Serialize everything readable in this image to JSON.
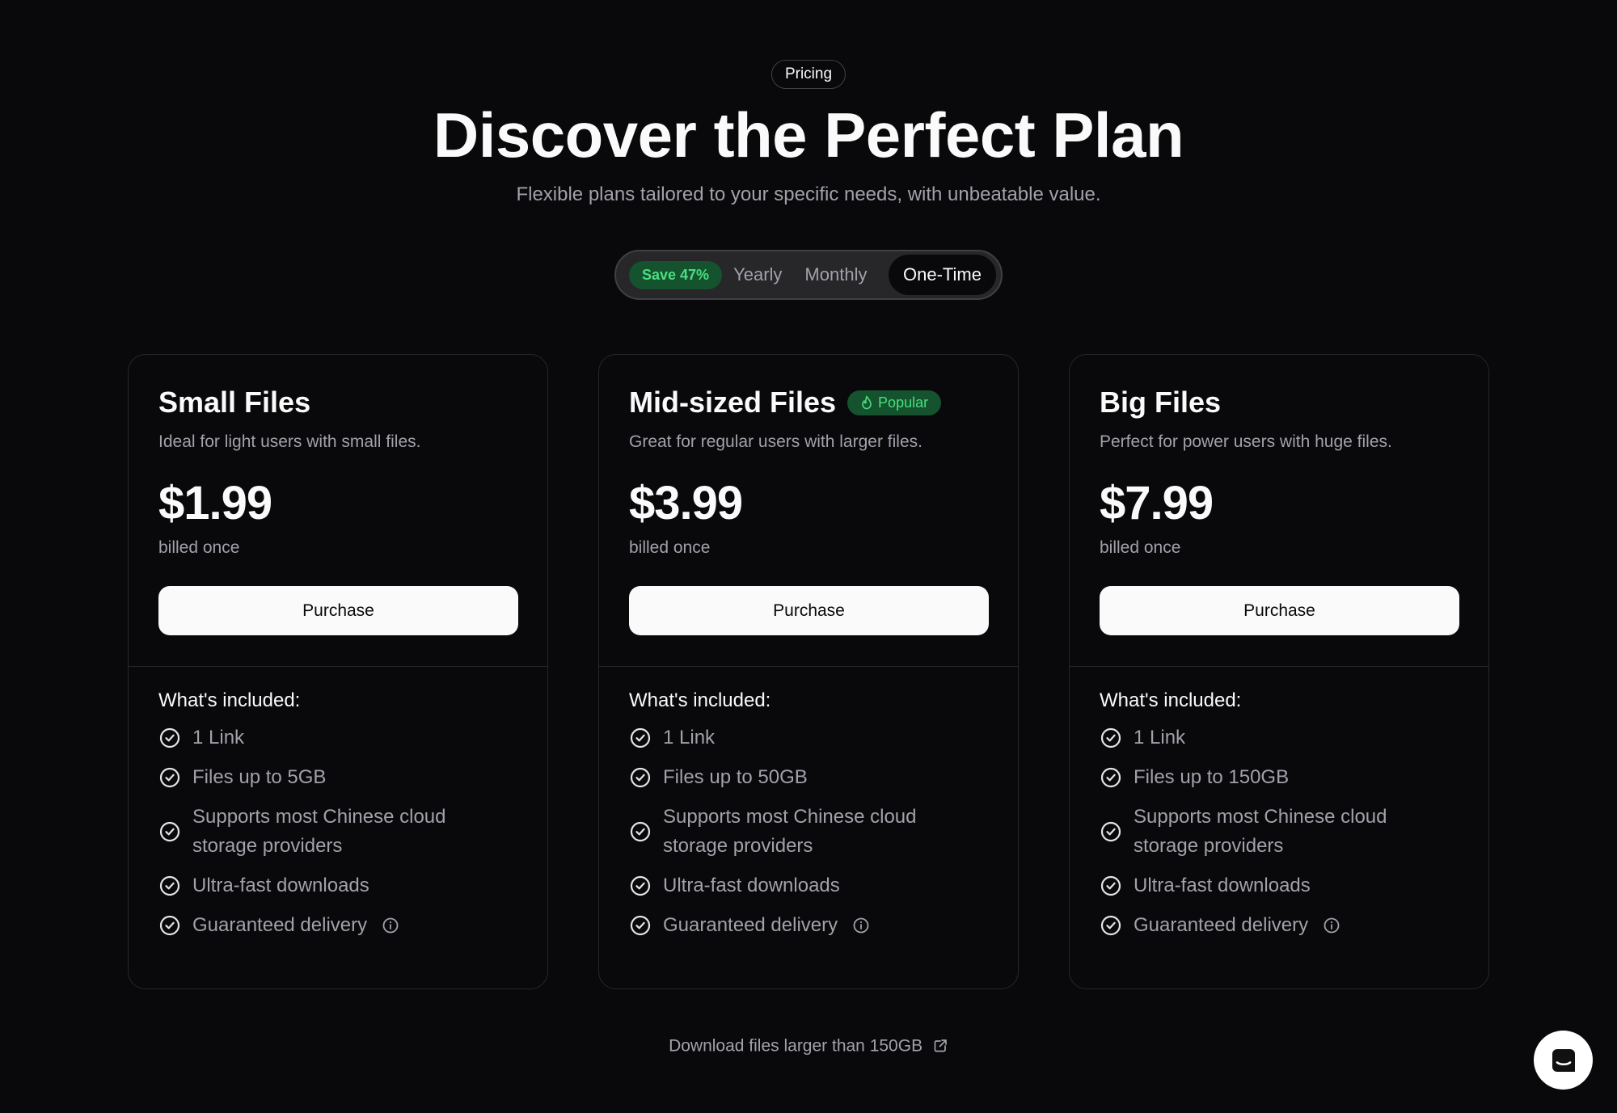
{
  "header": {
    "badge": "Pricing",
    "title": "Discover the Perfect Plan",
    "subtitle": "Flexible plans tailored to your specific needs, with unbeatable value."
  },
  "billing_toggle": {
    "save_badge": "Save 47%",
    "options": [
      "Yearly",
      "Monthly",
      "One-Time"
    ],
    "selected": "One-Time"
  },
  "plans": [
    {
      "name": "Small Files",
      "description": "Ideal for light users with small files.",
      "price": "$1.99",
      "billing": "billed once",
      "cta": "Purchase",
      "included_title": "What's included:",
      "features": [
        "1 Link",
        "Files up to 5GB",
        "Supports most Chinese cloud storage providers",
        "Ultra-fast downloads",
        "Guaranteed delivery"
      ]
    },
    {
      "name": "Mid-sized Files",
      "badge": "Popular",
      "description": "Great for regular users with larger files.",
      "price": "$3.99",
      "billing": "billed once",
      "cta": "Purchase",
      "included_title": "What's included:",
      "features": [
        "1 Link",
        "Files up to 50GB",
        "Supports most Chinese cloud storage providers",
        "Ultra-fast downloads",
        "Guaranteed delivery"
      ]
    },
    {
      "name": "Big Files",
      "description": "Perfect for power users with huge files.",
      "price": "$7.99",
      "billing": "billed once",
      "cta": "Purchase",
      "included_title": "What's included:",
      "features": [
        "1 Link",
        "Files up to 150GB",
        "Supports most Chinese cloud storage providers",
        "Ultra-fast downloads",
        "Guaranteed delivery"
      ]
    }
  ],
  "footer": {
    "link_text": "Download files larger than 150GB"
  },
  "icons": {
    "feature": "check-circle-icon",
    "info": "info-icon",
    "popular": "flame-icon",
    "external": "external-link-icon",
    "chat": "chat-icon"
  },
  "colors": {
    "background": "#09090b",
    "accent_green": "#4ade80",
    "badge_green_bg": "#14532d",
    "muted_text": "#a1a1aa"
  }
}
